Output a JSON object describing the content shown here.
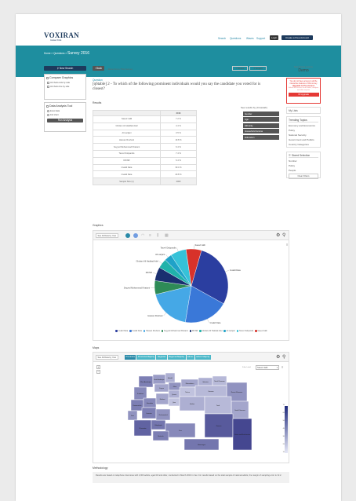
{
  "header": {
    "logo": "VOXIRAN",
    "logo_sub": "Iranian Polls",
    "nav": [
      "Search",
      "Questions",
      "Waves",
      "Support"
    ],
    "login": "Login",
    "create_account": "Create a Free Account"
  },
  "breadcrumb": {
    "home": "Home",
    "sep": "»",
    "questions": "Questions",
    "title": "Survey 2016"
  },
  "sidebar": {
    "new_search": "New Search",
    "compare_title": "Compare Graphics",
    "compare_opts": [
      "All charts side by side",
      "All charts line by side"
    ],
    "analysis_title": "Data Analysis Tool",
    "analysis_opts": [
      "Excel data",
      "Full chart"
    ],
    "run_analysis": "Run Analysis"
  },
  "toolbar": {
    "back": "Back",
    "more": "More From This Survey",
    "share": "Share",
    "export": "Export"
  },
  "question": {
    "label": "Question",
    "text": "[q6table] 2 - To which of the following prominent individuals would you say the candidate you voted for is closest?"
  },
  "results": {
    "label": "Results",
    "col_header": "2016",
    "rows": [
      {
        "name": "Saeed Jalili",
        "value": "7.2 %"
      },
      {
        "name": "Gholam Ali Haddad Adel",
        "value": "4.4 %"
      },
      {
        "name": "Ali Larijani",
        "value": "3.5 %"
      },
      {
        "name": "Hassan Rouhani",
        "value": "19.8 %"
      },
      {
        "name": "Seyyed Mohammad Khatami",
        "value": "6.4 %"
      },
      {
        "name": "Tarvel Ostipandis",
        "value": "7.4 %"
      },
      {
        "name": "DK/NR",
        "value": "6.4 %"
      },
      {
        "name": "Invalid Data",
        "value": "30.4 %"
      },
      {
        "name": "Invalid Data",
        "value": "20.8 %"
      },
      {
        "name": "Sample Size (n)",
        "value": "2000"
      }
    ]
  },
  "segments": {
    "title": "See results by (Crosstab)",
    "items": [
      "Gender",
      "Age",
      "Ethnicity",
      "Household income",
      "Education"
    ]
  },
  "right": {
    "viewing_label": "Now Access Level is",
    "viewing_value": "Demo",
    "upgrade_text": "You do not have access to all the interactive features of this survey",
    "upgrade_cta": "Upgrade to Pro Access",
    "upgrade_sub": "Unlock full access to all charts, analysis and data exports",
    "upgrade_btn": "Upgrade",
    "my_lists": "My Lists",
    "trending_title": "Trending Topics",
    "trending": [
      "Economy and Economics",
      "Policy",
      "National Security",
      "Government and Politics",
      "Country Categories"
    ],
    "saved_title": "Stored Selection",
    "saved": [
      "Number",
      "Policy",
      "People"
    ],
    "clear": "Clear Filters"
  },
  "graphics": {
    "label": "Graphics",
    "see_btn": "See All Data by Year"
  },
  "pie_chart": {
    "type": "pie",
    "slices": [
      {
        "label": "Invalid Data",
        "value": 30.4,
        "color": "#2b3ea0"
      },
      {
        "label": "Invalid Data",
        "value": 20.8,
        "color": "#3a78d8"
      },
      {
        "label": "Hassan Rouhani",
        "value": 19.8,
        "color": "#45a8e6"
      },
      {
        "label": "Seyyed Mohammad Khatami",
        "value": 6.4,
        "color": "#2e8b57"
      },
      {
        "label": "DK/NR",
        "value": 6.4,
        "color": "#1a2f70"
      },
      {
        "label": "Gholam Ali Haddad Adel",
        "value": 4.4,
        "color": "#20b2aa"
      },
      {
        "label": "Ali Larijani",
        "value": 3.5,
        "color": "#1fa2c8"
      },
      {
        "label": "Tarvel Ostipandis",
        "value": 7.4,
        "color": "#36c2d8"
      },
      {
        "label": "Saeed Jalili",
        "value": 7.2,
        "color": "#d8322a"
      }
    ]
  },
  "maps": {
    "label": "Maps",
    "see_btn": "See All Data by Year",
    "tabs": [
      "Provinces",
      "Provincial Majority",
      "Regional",
      "Regional Majority",
      "Ethnic",
      "Ethnic Majority"
    ],
    "select_label": "Filter Label",
    "select_value": "Saeed Jalili",
    "scale": [
      "70",
      "60",
      "50",
      "40",
      "30",
      "20",
      "10"
    ],
    "provinces": [
      {
        "name": "West Azarbaijan",
        "shade": 0.55
      },
      {
        "name": "East Azarbaijan",
        "shade": 0.4
      },
      {
        "name": "Ardabil",
        "shade": 0.3
      },
      {
        "name": "Gilan",
        "shade": 0.45
      },
      {
        "name": "Mazandaran",
        "shade": 0.35
      },
      {
        "name": "Golestan",
        "shade": 0.3
      },
      {
        "name": "North Khorasan",
        "shade": 0.25
      },
      {
        "name": "Razavi Khorasan",
        "shade": 0.45
      },
      {
        "name": "South Khorasan",
        "shade": 0.35
      },
      {
        "name": "Kurdistan",
        "shade": 0.5
      },
      {
        "name": "Zanjan",
        "shade": 0.35
      },
      {
        "name": "Qazvin",
        "shade": 0.3
      },
      {
        "name": "Tehran",
        "shade": 0.2
      },
      {
        "name": "Semnan",
        "shade": 0.25
      },
      {
        "name": "Kermanshah",
        "shade": 0.55
      },
      {
        "name": "Hamadan",
        "shade": 0.5
      },
      {
        "name": "Markazi",
        "shade": 0.35
      },
      {
        "name": "Qom",
        "shade": 0.2
      },
      {
        "name": "Isfahan",
        "shade": 0.3
      },
      {
        "name": "Yazd",
        "shade": 0.25
      },
      {
        "name": "Ilam",
        "shade": 0.45
      },
      {
        "name": "Lorestan",
        "shade": 0.55
      },
      {
        "name": "Khuzestan",
        "shade": 0.7
      },
      {
        "name": "Kohgiluyeh",
        "shade": 0.6
      },
      {
        "name": "Chaharmahal",
        "shade": 0.45
      },
      {
        "name": "Fars",
        "shade": 0.5
      },
      {
        "name": "Bushehr",
        "shade": 0.55
      },
      {
        "name": "Kerman",
        "shade": 0.75
      },
      {
        "name": "Hormozgan",
        "shade": 0.6
      },
      {
        "name": "Sistan and Baluchestan",
        "shade": 0.85
      }
    ]
  },
  "methodology": {
    "label": "Methodology",
    "text": "Results are based on telephone interviews with 2,000 adults, aged 18 and older, conducted in March 2016 in Iran. For results based on the total sample of national adults, the margin of sampling error is ±2.2."
  }
}
